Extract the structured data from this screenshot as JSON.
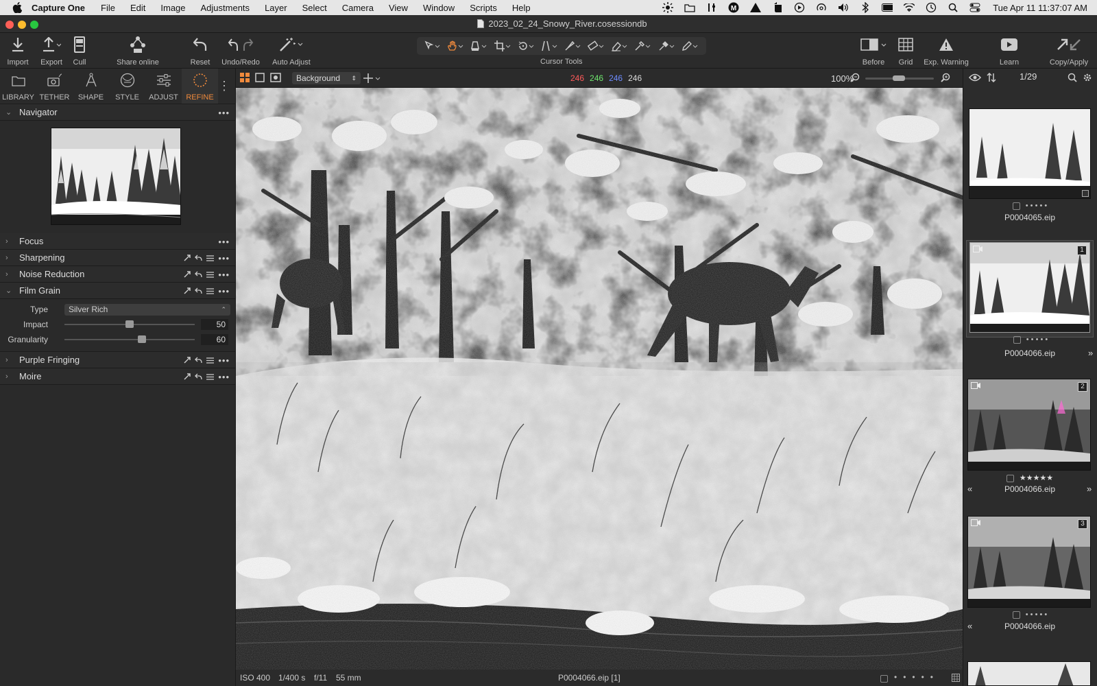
{
  "menubar": {
    "app": "Capture One",
    "items": [
      "File",
      "Edit",
      "Image",
      "Adjustments",
      "Layer",
      "Select",
      "Camera",
      "View",
      "Window",
      "Scripts",
      "Help"
    ],
    "clock": "Tue Apr 11  11:37:07 AM"
  },
  "window": {
    "title": "2023_02_24_Snowy_River.cosessiondb"
  },
  "toolbar": {
    "import": "Import",
    "export": "Export",
    "cull": "Cull",
    "share": "Share online",
    "reset": "Reset",
    "undo_redo": "Undo/Redo",
    "auto_adjust": "Auto Adjust",
    "cursor_tools": "Cursor Tools",
    "before": "Before",
    "grid": "Grid",
    "exp_warning": "Exp. Warning",
    "learn": "Learn",
    "copy_apply": "Copy/Apply"
  },
  "tool_tabs": [
    "LIBRARY",
    "TETHER",
    "SHAPE",
    "STYLE",
    "ADJUST",
    "REFINE"
  ],
  "panel": {
    "navigator": "Navigator",
    "focus": "Focus",
    "sharpening": "Sharpening",
    "noise_reduction": "Noise Reduction",
    "film_grain": {
      "title": "Film Grain",
      "type_label": "Type",
      "type_value": "Silver Rich",
      "impact_label": "Impact",
      "impact_value": "50",
      "impact_fraction": 0.5,
      "granularity_label": "Granularity",
      "granularity_value": "60",
      "granularity_fraction": 0.6
    },
    "purple_fringing": "Purple Fringing",
    "moire": "Moire"
  },
  "viewer": {
    "layer": "Background",
    "rgb": {
      "r": "246",
      "g": "246",
      "b": "246",
      "l": "246"
    },
    "zoom": "100%",
    "status": {
      "iso": "ISO 400",
      "shutter": "1/400 s",
      "aperture": "f/11",
      "focal": "55 mm",
      "filename": "P0004066.eip [1]"
    }
  },
  "browser": {
    "count": "1/29",
    "thumbs": [
      {
        "name": "P0004065.eip",
        "meta": "•  •  •  •  •",
        "number": ""
      },
      {
        "name": "P0004066.eip",
        "meta": "•  •  •  •  •",
        "number": "1"
      },
      {
        "name": "P0004066.eip",
        "meta": "★★★★★",
        "number": "2"
      },
      {
        "name": "P0004066.eip",
        "meta": "•  •  •  •  •",
        "number": "3"
      }
    ]
  },
  "colors": {
    "accent": "#f08a3c",
    "red": "#ff5a5a",
    "green": "#6ee66e",
    "blue": "#6e8cff"
  }
}
